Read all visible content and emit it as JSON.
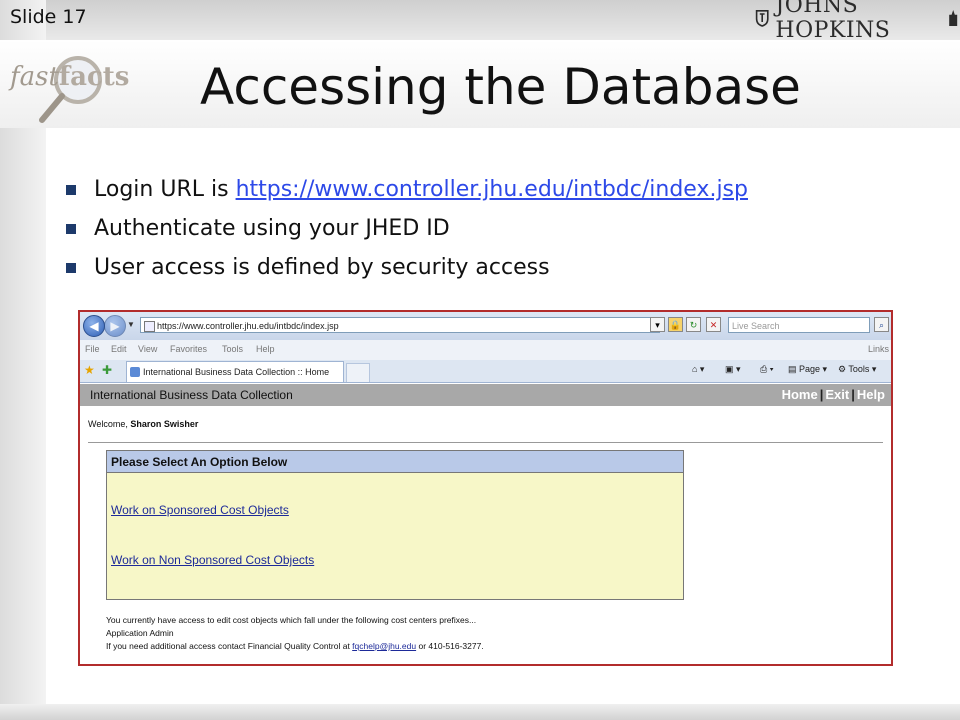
{
  "slide": {
    "number": "Slide 17",
    "logo_text": "JOHNS HOPKINS",
    "badge_text_1": "fast",
    "badge_text_2": "facts",
    "title": "Accessing the Database",
    "bullets": [
      {
        "prefix": "Login URL is ",
        "link": "https://www.controller.jhu.edu/intbdc/index.jsp"
      },
      {
        "text": "Authenticate using your JHED ID"
      },
      {
        "text": "User access is defined by security access"
      }
    ]
  },
  "browser": {
    "address": "https://www.controller.jhu.edu/intbdc/index.jsp",
    "search_placeholder": "Live Search",
    "menu": [
      "File",
      "Edit",
      "View",
      "Favorites",
      "Tools",
      "Help"
    ],
    "links_label": "Links",
    "tab_title": "International Business Data Collection :: Home",
    "toolbar": {
      "page": "Page",
      "tools": "Tools"
    }
  },
  "app": {
    "title": "International Business Data Collection",
    "nav": [
      "Home",
      "Exit",
      "Help"
    ],
    "welcome_label": "Welcome,",
    "user_name": "Sharon Swisher",
    "options_heading": "Please Select An Option Below",
    "option_1": "Work on Sponsored Cost Objects",
    "option_2": "Work on Non Sponsored Cost Objects",
    "note_1": "You currently have access to edit cost objects which fall under the following cost centers prefixes...",
    "note_2": "Application Admin",
    "note_3_prefix": "If you need additional access contact Financial Quality Control at ",
    "note_3_email": "fqchelp@jhu.edu",
    "note_3_suffix": " or 410-516-3277."
  }
}
